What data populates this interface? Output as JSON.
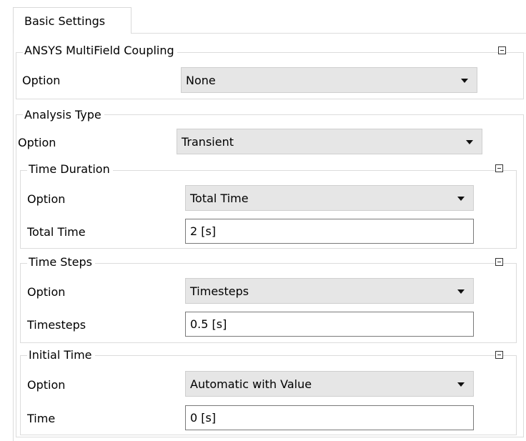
{
  "tab": {
    "label": "Basic Settings"
  },
  "coupling": {
    "title": "ANSYS MultiField Coupling",
    "option_label": "Option",
    "option_value": "None"
  },
  "analysis": {
    "title": "Analysis Type",
    "option_label": "Option",
    "option_value": "Transient",
    "time_duration": {
      "title": "Time Duration",
      "option_label": "Option",
      "option_value": "Total Time",
      "field_label": "Total Time",
      "field_value": "2 [s]"
    },
    "time_steps": {
      "title": "Time Steps",
      "option_label": "Option",
      "option_value": "Timesteps",
      "field_label": "Timesteps",
      "field_value": "0.5 [s]"
    },
    "initial_time": {
      "title": "Initial Time",
      "option_label": "Option",
      "option_value": "Automatic with Value",
      "field_label": "Time",
      "field_value": "0 [s]"
    }
  }
}
